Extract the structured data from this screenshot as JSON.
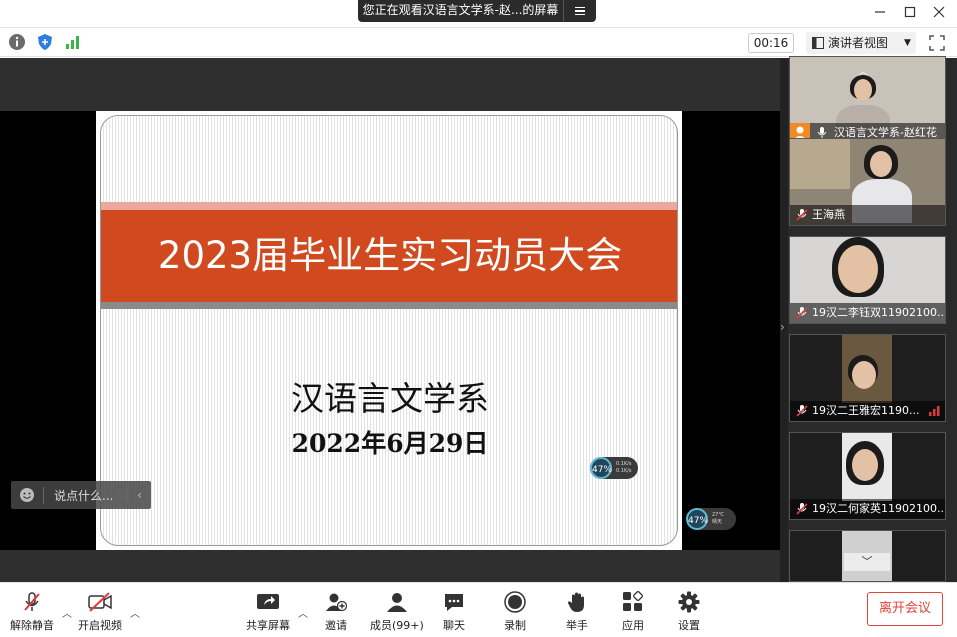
{
  "window": {
    "share_banner": "您正在观看汉语言文学系-赵...的屏幕"
  },
  "topbar": {
    "timer": "00:16",
    "view_mode": "演讲者视图",
    "icons": [
      "info-icon",
      "shield-icon",
      "signal-icon"
    ]
  },
  "slide": {
    "title": "2023届毕业生实习动员大会",
    "department": "汉语言文学系",
    "date": "2022年6月29日",
    "accent_color": "#d14a1f"
  },
  "speed_widget": {
    "slide": {
      "percent": "47%",
      "line1": "0.1K/s",
      "line2": "0.1K/s"
    },
    "stage": {
      "percent": "47%",
      "line1": "27℃",
      "line2": "晴天"
    }
  },
  "chat": {
    "placeholder": "说点什么..."
  },
  "participants": [
    {
      "name": "汉语言文学系-赵红花",
      "muted": false,
      "host": true
    },
    {
      "name": "王海燕",
      "muted": true
    },
    {
      "name": "19汉二李钰双11902100...",
      "muted": true
    },
    {
      "name": "19汉二王雅宏1190...",
      "muted": true
    },
    {
      "name": "19汉二何家英11902100...",
      "muted": true
    }
  ],
  "bottombar": {
    "unmute": "解除静音",
    "start_video": "开启视频",
    "share_screen": "共享屏幕",
    "invite": "邀请",
    "members": "成员(99+)",
    "chat": "聊天",
    "record": "录制",
    "raise_hand": "举手",
    "apps": "应用",
    "settings": "设置",
    "leave": "离开会议"
  }
}
